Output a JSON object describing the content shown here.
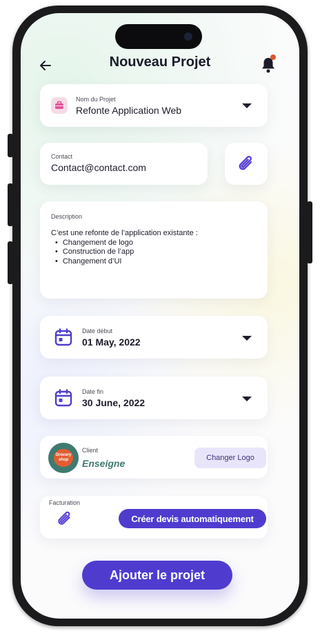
{
  "header": {
    "title": "Nouveau Projet",
    "back_icon": "arrow-left-icon",
    "notification_icon": "bell-icon",
    "notification_dot_color": "#e0552e"
  },
  "project": {
    "label": "Nom du Projet",
    "value": "Refonte Application Web",
    "icon": "briefcase-icon"
  },
  "contact": {
    "label": "Contact",
    "value": "Contact@contact.com",
    "attach_icon": "paperclip-icon"
  },
  "description": {
    "label": "Description",
    "intro": "C’est une refonte de l’application existante :",
    "items": [
      "Changement de logo",
      "Construction de l’app",
      "Changement d’UI"
    ]
  },
  "start_date": {
    "label": "Date début",
    "value": "01 May, 2022",
    "icon": "calendar-icon"
  },
  "end_date": {
    "label": "Date fin",
    "value": "30 June, 2022",
    "icon": "calendar-icon"
  },
  "client": {
    "label": "Client",
    "name": "Enseigne",
    "logo_text": "Grocery shop",
    "change_logo_label": "Changer Logo"
  },
  "billing": {
    "label": "Facturation",
    "attach_icon": "paperclip-icon",
    "create_quote_label": "Créer devis automatiquement"
  },
  "submit_label": "Ajouter le projet",
  "colors": {
    "accent": "#4f3ccf",
    "accent_light": "#e8e5fb",
    "client_green": "#3f7a70",
    "text": "#1c1c2a"
  }
}
